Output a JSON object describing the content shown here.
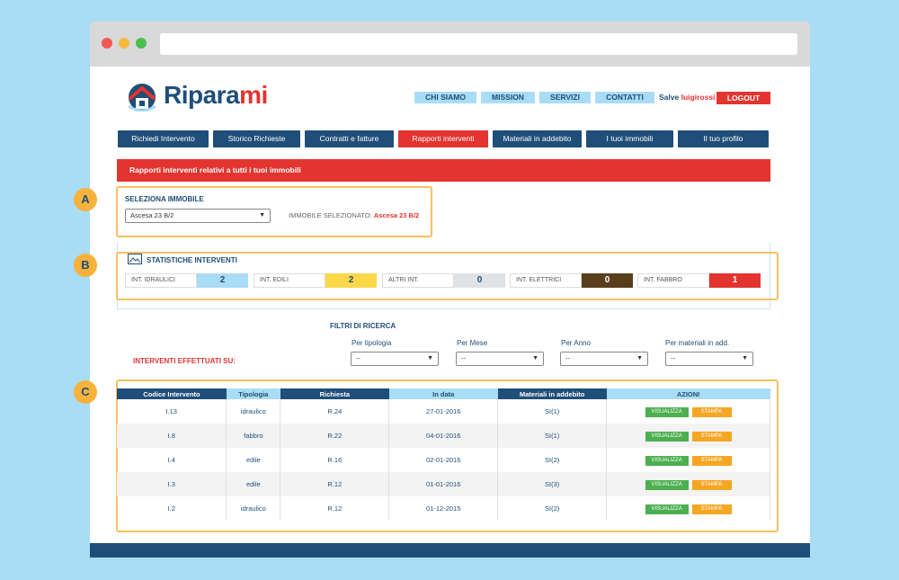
{
  "logo": {
    "text_main": "Ripara",
    "text_accent": "mi"
  },
  "top_nav": {
    "items": [
      "CHI SIAMO",
      "MISSION",
      "SERVIZI",
      "CONTATTI"
    ],
    "greeting": "Salve",
    "username": "luigirossi",
    "logout": "LOGOUT"
  },
  "main_nav": {
    "items": [
      "Richiedi Intervento",
      "Storico Richieste",
      "Contratti e fatture",
      "Rapporti interventi",
      "Materiali in addebito",
      "I tuoi immobili",
      "Il tuo profilo"
    ],
    "active": "Rapporti interventi"
  },
  "banner": "Rapporti interventi relativi a tutti i tuoi immobili",
  "callouts": [
    "A",
    "B",
    "C"
  ],
  "selezione": {
    "title": "SELEZIONA IMMOBILE",
    "value": "Ascesa 23 B/2",
    "selected_label": "IMMOBILE SELEZIONATO:",
    "selected_value": "Ascesa 23 B/2"
  },
  "stats": {
    "title": "STATISTICHE INTERVENTI",
    "items": [
      {
        "label": "INT. IDRAULICI",
        "value": "2",
        "color": "#a9dcf5"
      },
      {
        "label": "INT. EDILI",
        "value": "2",
        "color": "#fbd84a"
      },
      {
        "label": "ALTRI INT.",
        "value": "0",
        "color": "#dfe3e6"
      },
      {
        "label": "INT. ELETTRICI",
        "value": "0",
        "color": "#5a3e1b"
      },
      {
        "label": "INT. FABBRO",
        "value": "1",
        "color": "#e3342f"
      }
    ]
  },
  "filtri": {
    "title": "FILTRI DI RICERCA",
    "interventi_label": "INTERVENTI EFFETTUATI SU:",
    "filters": [
      {
        "label": "Per tipologia",
        "value": "--"
      },
      {
        "label": "Per Mese",
        "value": "--"
      },
      {
        "label": "Per Anno",
        "value": "--"
      },
      {
        "label": "Per materiali in add.",
        "value": "--"
      }
    ]
  },
  "table": {
    "headers": [
      "Codice Intervento",
      "Tipologia",
      "Richiesta",
      "In data",
      "Materiali in addebito",
      "AZIONI"
    ],
    "rows": [
      [
        "I.13",
        "idraulico",
        "R.24",
        "27-01-2016",
        "SI(1)"
      ],
      [
        "I.8",
        "fabbro",
        "R.22",
        "04-01-2016",
        "SI(1)"
      ],
      [
        "I.4",
        "edile",
        "R.16",
        "02-01-2016",
        "SI(2)"
      ],
      [
        "I.3",
        "edile",
        "R.12",
        "01-01-2016",
        "SI(3)"
      ],
      [
        "I.2",
        "idraulico",
        "R.12",
        "01-12-2015",
        "SI(2)"
      ]
    ],
    "action_view": "VISUALIZZA",
    "action_print": "STAMPA"
  },
  "colors": {
    "brand_dark": "#1f4e79",
    "brand_red": "#e3342f",
    "light_blue": "#a9dcf5",
    "callout": "#f7b23b"
  }
}
